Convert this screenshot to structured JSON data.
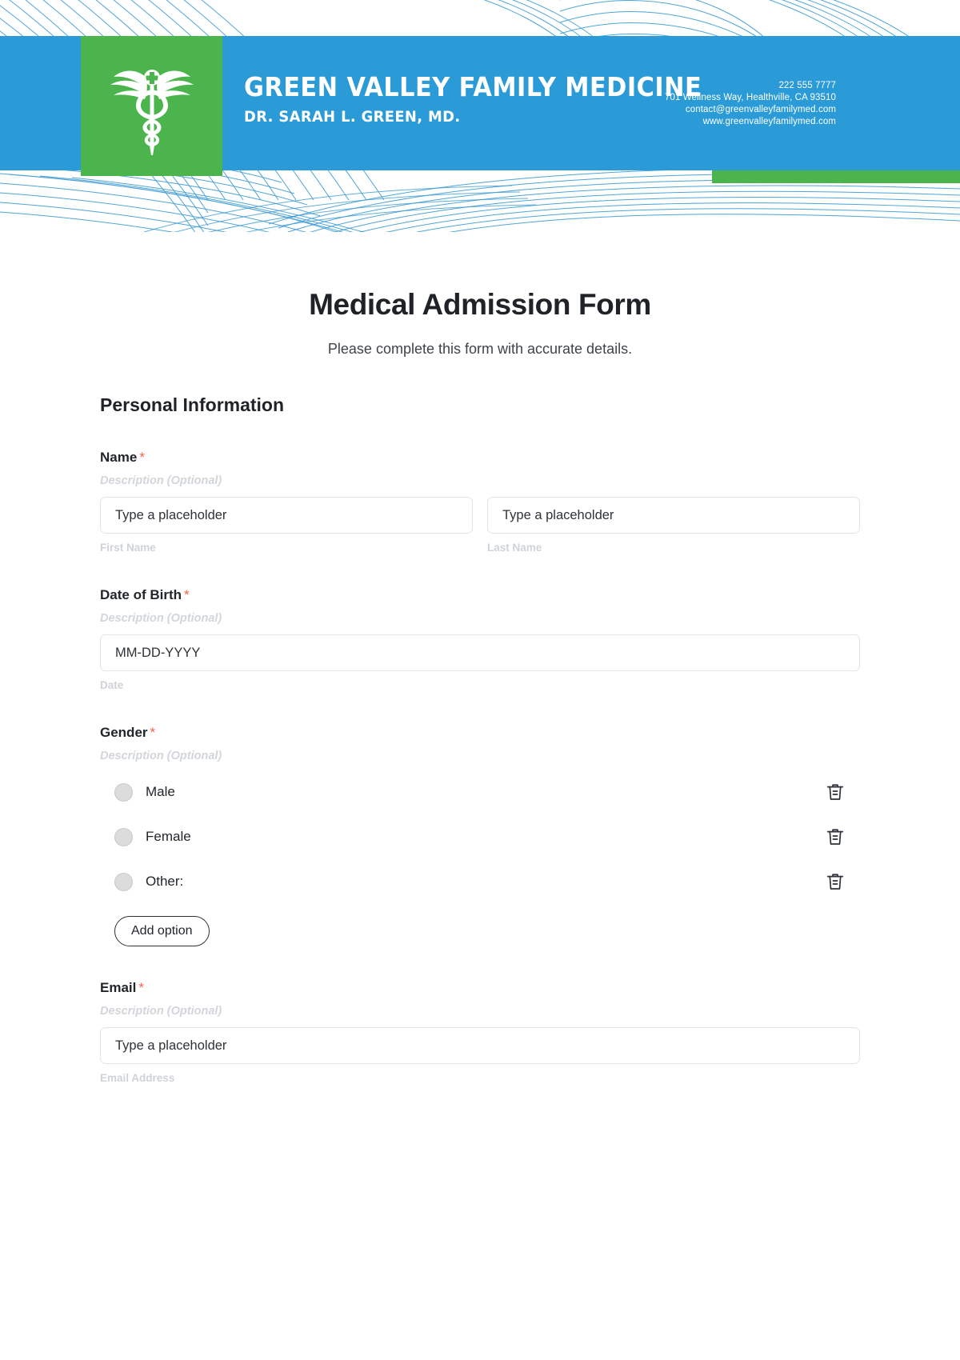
{
  "letterhead": {
    "practice_name": "GREEN VALLEY FAMILY MEDICINE",
    "doctor_name": "DR. SARAH L. GREEN, MD.",
    "logo_icon": "caduceus-icon",
    "contact": {
      "phone": "222 555 7777",
      "address": "701 Wellness Way, Healthville, CA 93510",
      "email": "contact@greenvalleyfamilymed.com",
      "website": "www.greenvalleyfamilymed.com"
    },
    "colors": {
      "banner_blue": "#2b9bd8",
      "accent_green": "#4cb44d",
      "wave_line": "#3d9bd4"
    }
  },
  "form": {
    "title": "Medical Admission Form",
    "subtitle": "Please complete this form with accurate details.",
    "section_heading": "Personal Information",
    "required_marker": "*",
    "description_placeholder": "Description (Optional)",
    "required_color": "#f4604a",
    "fields": {
      "name": {
        "label": "Name",
        "description": "Description (Optional)",
        "first": {
          "placeholder": "Type a placeholder",
          "value": "",
          "sub_label": "First Name"
        },
        "last": {
          "placeholder": "Type a placeholder",
          "value": "",
          "sub_label": "Last Name"
        }
      },
      "dob": {
        "label": "Date of Birth",
        "description": "Description (Optional)",
        "placeholder": "MM-DD-YYYY",
        "value": "",
        "sub_label": "Date"
      },
      "gender": {
        "label": "Gender",
        "description": "Description (Optional)",
        "options": [
          {
            "label": "Male",
            "selected": false,
            "delete_icon": "trash-icon"
          },
          {
            "label": "Female",
            "selected": false,
            "delete_icon": "trash-icon"
          },
          {
            "label": "Other:",
            "selected": false,
            "delete_icon": "trash-icon"
          }
        ],
        "add_option_label": "Add option"
      },
      "email": {
        "label": "Email",
        "description": "Description (Optional)",
        "placeholder": "Type a placeholder",
        "value": "",
        "sub_label": "Email Address"
      }
    }
  }
}
